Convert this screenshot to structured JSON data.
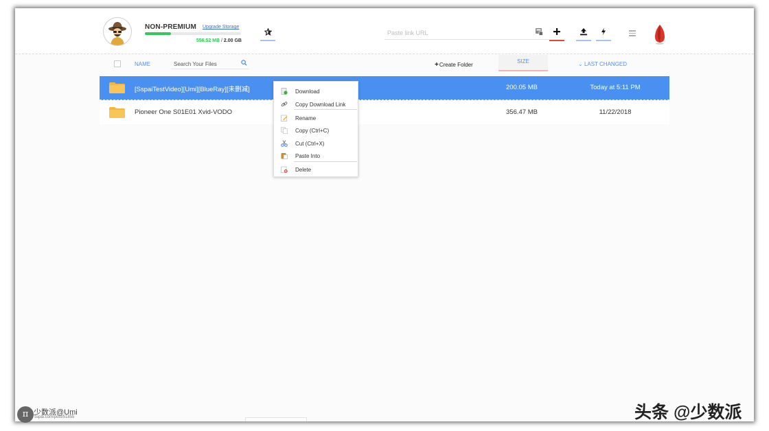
{
  "account": {
    "tier": "NON-PREMIUM",
    "upgrade_label": "Upgrade Storage",
    "storage_used": "556.52 MB",
    "storage_separator": " / ",
    "storage_total": "2.00 GB",
    "storage_used_fraction": 0.27
  },
  "toolbar": {
    "paste_placeholder": "Paste link URL",
    "icons": [
      "favorites-star-icon",
      "remote-upload-icon",
      "add-icon",
      "upload-icon",
      "flash-icon",
      "menu-icon"
    ]
  },
  "columns": {
    "name": "NAME",
    "search_placeholder": "Search Your Files",
    "create_folder_plus": "+",
    "create_folder": "Create Folder",
    "size": "SIZE",
    "last_changed_arrow": "⌄",
    "last_changed": "LAST CHANGED"
  },
  "files": [
    {
      "name": "[SspaiTestVideo][Umi][BlueRay][未删减]",
      "size": "200.05 MB",
      "changed": "Today at 5:11 PM",
      "selected": true
    },
    {
      "name": "Pioneer One S01E01 Xvid-VODO",
      "size": "356.47 MB",
      "changed": "11/22/2018",
      "selected": false
    }
  ],
  "context_menu": {
    "items": [
      {
        "label": "Download",
        "icon": "download-icon"
      },
      {
        "label": "Copy Download Link",
        "icon": "link-icon"
      },
      {
        "label": "Rename",
        "icon": "rename-icon"
      },
      {
        "label": "Copy (Ctrl+C)",
        "icon": "copy-icon"
      },
      {
        "label": "Cut (Ctrl+X)",
        "icon": "cut-icon"
      },
      {
        "label": "Paste Into",
        "icon": "paste-icon"
      },
      {
        "label": "Delete",
        "icon": "delete-icon"
      }
    ]
  },
  "watermarks": {
    "left_symbol": "π",
    "left_title": "少数派@Umi",
    "left_sub": "sspai.com/post/51855",
    "right": "头条 @少数派"
  },
  "colors": {
    "selection": "#4a90f0",
    "accent_blue": "#5b8fe0",
    "storage_green": "#34c759",
    "add_underline": "#e8433a",
    "logo_red": "#d9352b"
  }
}
